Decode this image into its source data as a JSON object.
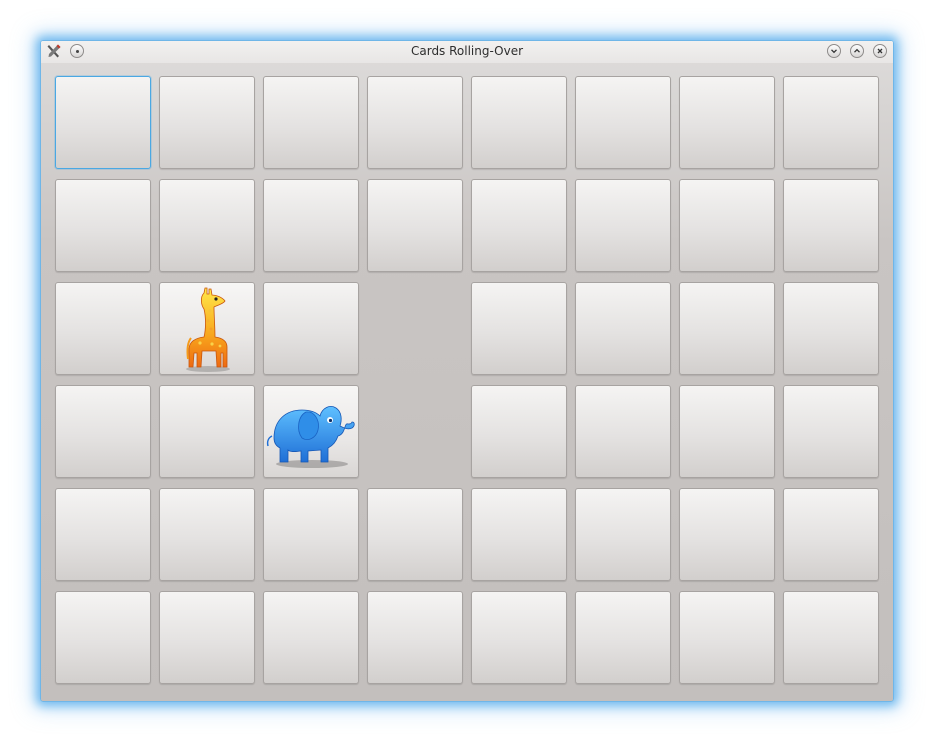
{
  "window": {
    "title": "Cards Rolling-Over",
    "accent_color": "#4aa8e3"
  },
  "titlebar": {
    "app_icon": "tools-icon",
    "menu_button_icon": "dot-icon",
    "minimize_icon": "chevron-down-icon",
    "maximize_icon": "chevron-up-icon",
    "close_icon": "close-icon"
  },
  "board": {
    "columns": 8,
    "rows": 6,
    "focused_card": "row 0, column 0",
    "cards": [
      [
        "back",
        "back",
        "back",
        "back",
        "back",
        "back",
        "back",
        "back"
      ],
      [
        "back",
        "back",
        "back",
        "back",
        "back",
        "back",
        "back",
        "back"
      ],
      [
        "back",
        "giraffe",
        "back",
        "empty",
        "back",
        "back",
        "back",
        "back"
      ],
      [
        "back",
        "back",
        "elephant",
        "empty",
        "back",
        "back",
        "back",
        "back"
      ],
      [
        "back",
        "back",
        "back",
        "back",
        "back",
        "back",
        "back",
        "back"
      ],
      [
        "back",
        "back",
        "back",
        "back",
        "back",
        "back",
        "back",
        "back"
      ]
    ]
  }
}
